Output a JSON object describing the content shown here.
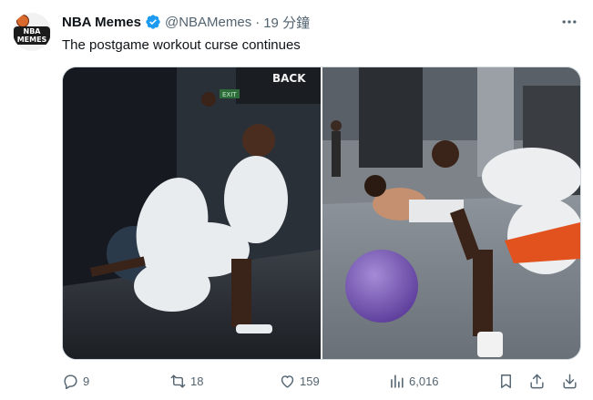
{
  "tweet": {
    "avatar_text": [
      "NBA",
      "MEMES"
    ],
    "author_name": "NBA Memes",
    "handle": "@NBAMemes",
    "separator": "·",
    "time": "19 分鐘",
    "text": "The postgame workout curse continues",
    "more_icon": "more-horizontal-icon",
    "verified_icon": "verified-badge-icon"
  },
  "media": {
    "left_photo": {
      "wall_text": "BACK",
      "exit_sign": "EXIT"
    }
  },
  "actions": {
    "replies": "9",
    "retweets": "18",
    "likes": "159",
    "views": "6,016"
  },
  "colors": {
    "text": "#0f1419",
    "secondary": "#536471",
    "verified": "#1d9bf0",
    "border": "#cfd9de"
  }
}
